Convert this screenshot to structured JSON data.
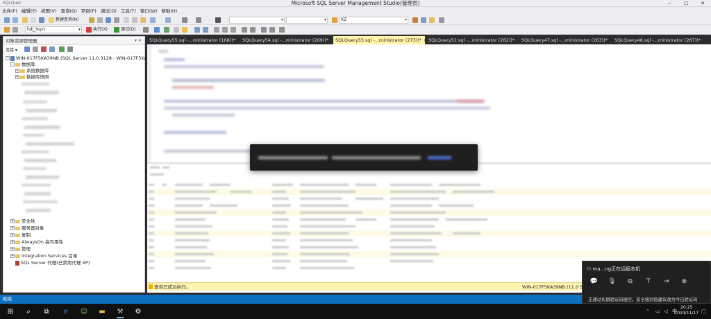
{
  "window": {
    "app_left": "SQLQuer",
    "title": "Microsoft SQL Server Management Studio(管理员)",
    "minimize": "─",
    "maximize": "☐",
    "close": "✕"
  },
  "menu": [
    "文件(F)",
    "编辑(E)",
    "视图(V)",
    "查询(Q)",
    "项目(P)",
    "调试(D)",
    "工具(T)",
    "窗口(W)",
    "帮助(H)"
  ],
  "toolbar1": {
    "new_query": "新建查询(N)",
    "search_combo": "XZ"
  },
  "toolbar2": {
    "database": "hdj_hqxt",
    "execute": "执行(X)",
    "debug": "调试(D)"
  },
  "object_explorer": {
    "title": "对象资源管理器",
    "pin": "▾ ✕",
    "connect": "连接 ▾",
    "server": "WIN-017F5KA39NB (SQL Server 11.0.3128 - WIN-017F5KA3",
    "databases": "数据库",
    "system_databases": "系统数据库",
    "snapshots": "数据库快照",
    "security": "安全性",
    "server_objects": "服务器对象",
    "replication": "复制",
    "alwayson": "AlwaysOn 高可用性",
    "management": "管理",
    "integration": "Integration Services 目录",
    "agent": "SQL Server 代理(已禁用代理 XP)"
  },
  "tabs": [
    {
      "label": "SQLQuery55.sql -...ministrator (168))*"
    },
    {
      "label": "SQLQuery54.sql -...ministrator (269))*"
    },
    {
      "label": "SQLQuery53.sql -...ministrator (273))*",
      "active": true
    },
    {
      "label": "SQLQuery51.sql -...ministrator (262))*"
    },
    {
      "label": "SQLQuery47.sql -...ministrator (263))*"
    },
    {
      "label": "SQLQuery46.sql -...ministrator (267))*"
    }
  ],
  "query_status": {
    "message": "查询已成功执行。",
    "server": "WIN-017F5KA39NB (11.0 S"
  },
  "app_status": "就绪",
  "rdp_panel": {
    "user": "ma...ng正在远程本机",
    "notice": "正通过长期验证码被控。安全级别低建议改为今日验证码"
  },
  "clock": {
    "time": "20:25",
    "date": "2024/11/17"
  },
  "tray": {
    "lang": "中"
  },
  "colors": {
    "accent": "#0e70c0",
    "active_tab": "#fff4a8",
    "status_bg": "#fff3b0"
  }
}
